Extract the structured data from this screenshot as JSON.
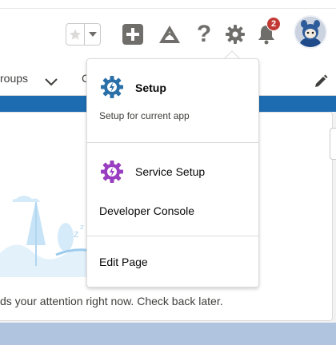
{
  "header": {
    "notification_count": "2",
    "colors": {
      "accent": "#1d6cb2",
      "badge": "#c23934",
      "icon_gray": "#706e6b",
      "service_purple": "#9a3ec1",
      "setup_blue": "#2a6fa8"
    }
  },
  "nav": {
    "groups_label": "roups",
    "partial_item": "C"
  },
  "card": {
    "message": "ds your attention right now. Check back later."
  },
  "setup_menu": {
    "setup": {
      "title": "Setup",
      "subtitle": "Setup for current app",
      "icon": "gear-bolt-icon"
    },
    "service_setup": {
      "label": "Service Setup",
      "icon": "gear-bolt-icon"
    },
    "developer_console": {
      "label": "Developer Console"
    },
    "edit_page": {
      "label": "Edit Page"
    }
  }
}
